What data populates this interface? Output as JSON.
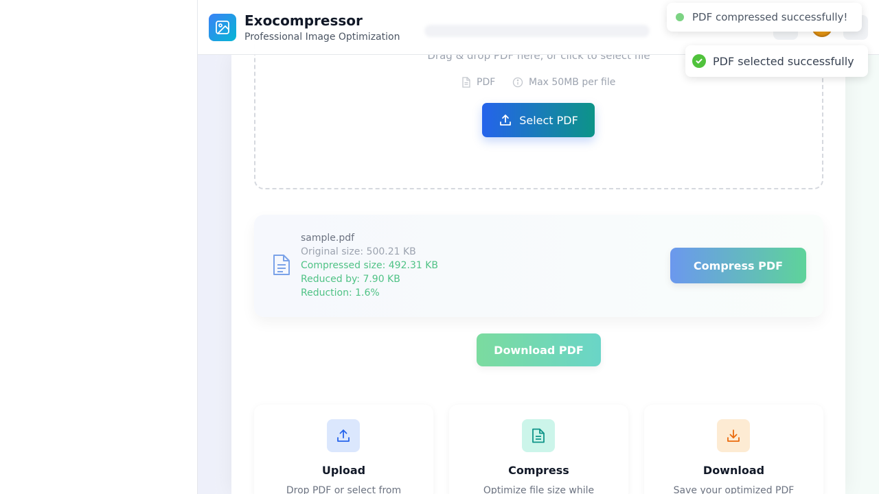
{
  "app": {
    "title": "Exocompressor",
    "subtitle": "Professional Image Optimization"
  },
  "dropzone": {
    "hint": "Drag & drop PDF here, or click to select file",
    "format_label": "PDF",
    "size_limit": "Max 50MB per file",
    "select_button": "Select PDF"
  },
  "file": {
    "name": "sample.pdf",
    "original_size": "Original size: 500.21 KB",
    "compressed_size": "Compressed size: 492.31 KB",
    "reduced_by": "Reduced by: 7.90 KB",
    "reduction": "Reduction: 1.6%",
    "compress_button": "Compress PDF"
  },
  "download_button": "Download PDF",
  "steps": [
    {
      "title": "Upload",
      "description": "Drop PDF or select from"
    },
    {
      "title": "Compress",
      "description": "Optimize file size while"
    },
    {
      "title": "Download",
      "description": "Save your optimized PDF"
    }
  ],
  "toasts": [
    {
      "message": "PDF compressed successfully!"
    },
    {
      "message": "PDF selected successfully"
    }
  ],
  "colors": {
    "primary_gradient_start": "#2563eb",
    "primary_gradient_end": "#0d9488",
    "success": "#50c23c",
    "stat_green": "#4fc285"
  },
  "icons": {
    "logo": "image-icon",
    "file": "file-text-icon",
    "upload": "upload-icon",
    "download": "download-icon",
    "info": "info-icon",
    "check": "check-icon"
  }
}
